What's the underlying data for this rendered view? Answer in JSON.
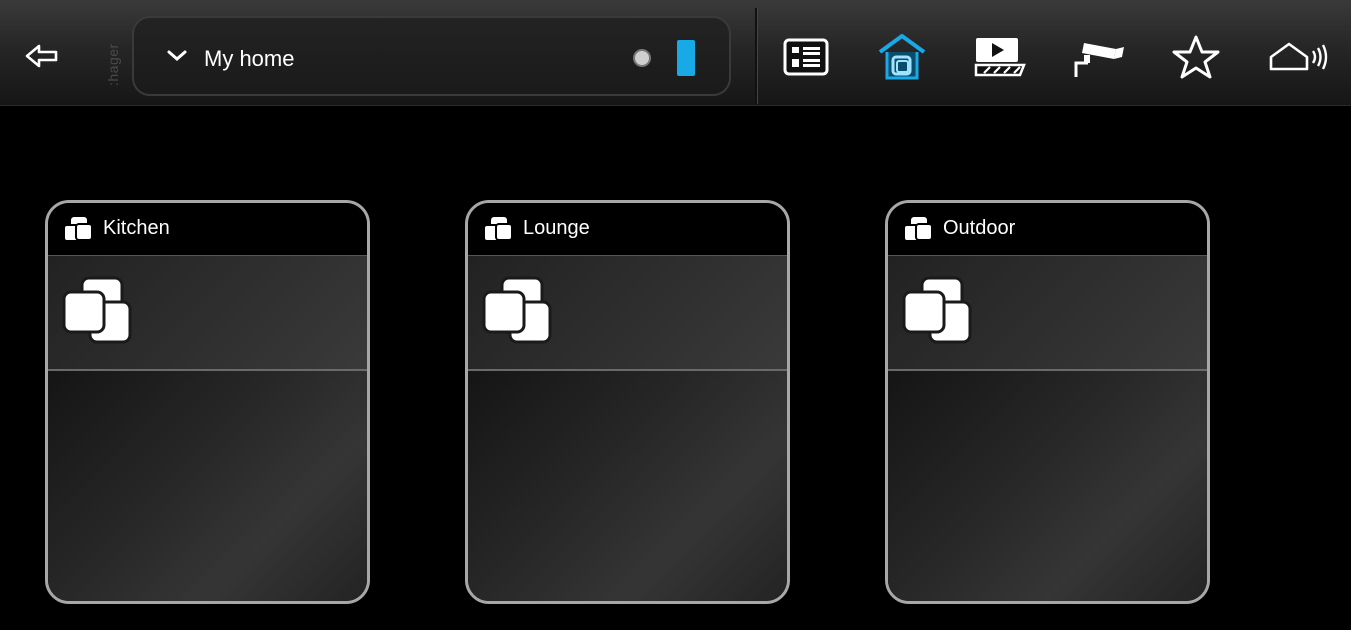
{
  "app": {
    "brand": ":hager",
    "selector_label": "My home"
  },
  "colors": {
    "accent": "#19a9e6",
    "card_border": "#a7a7a7",
    "background": "#000000"
  },
  "toolbar": {
    "icons": [
      "back-arrow-icon",
      "list-icon",
      "home-building-icon",
      "media-player-icon",
      "camera-icon",
      "star-icon",
      "home-broadcast-icon"
    ],
    "active": "home-building-icon"
  },
  "rooms": [
    {
      "name": "Kitchen",
      "icon": "rooms-icon"
    },
    {
      "name": "Lounge",
      "icon": "rooms-icon"
    },
    {
      "name": "Outdoor",
      "icon": "rooms-icon"
    }
  ]
}
